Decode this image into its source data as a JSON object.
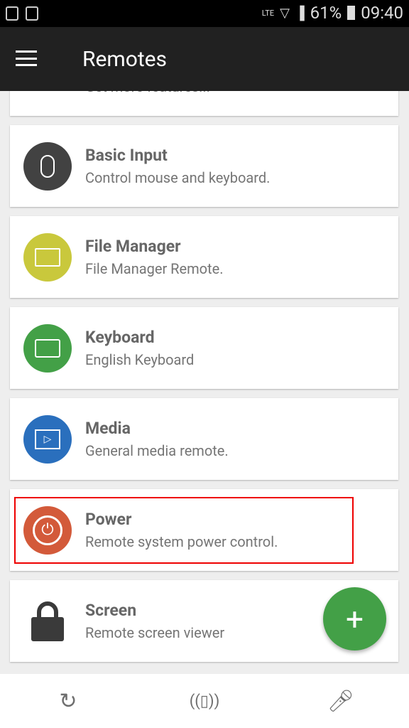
{
  "status": {
    "battery": "61%",
    "time": "09:40",
    "network": "LTE"
  },
  "appbar": {
    "title": "Remotes"
  },
  "partial_card": {
    "subtitle": "Get more features..."
  },
  "remotes": [
    {
      "title": "Basic Input",
      "subtitle": "Control mouse and keyboard.",
      "icon": "mouse-icon",
      "color": "#424242"
    },
    {
      "title": "File Manager",
      "subtitle": "File Manager Remote.",
      "icon": "folder-icon",
      "color": "#c9c83c"
    },
    {
      "title": "Keyboard",
      "subtitle": "English Keyboard",
      "icon": "keyboard-icon",
      "color": "#43a047"
    },
    {
      "title": "Media",
      "subtitle": "General media remote.",
      "icon": "media-icon",
      "color": "#2a6fbd"
    },
    {
      "title": "Power",
      "subtitle": "Remote system power control.",
      "icon": "power-icon",
      "color": "#d35a3a"
    },
    {
      "title": "Screen",
      "subtitle": "Remote screen viewer",
      "icon": "lock-icon",
      "color": "#3a3a3a"
    }
  ],
  "fab": {
    "label": "+"
  },
  "highlight": {
    "target": "Power",
    "color": "#ee0000"
  }
}
